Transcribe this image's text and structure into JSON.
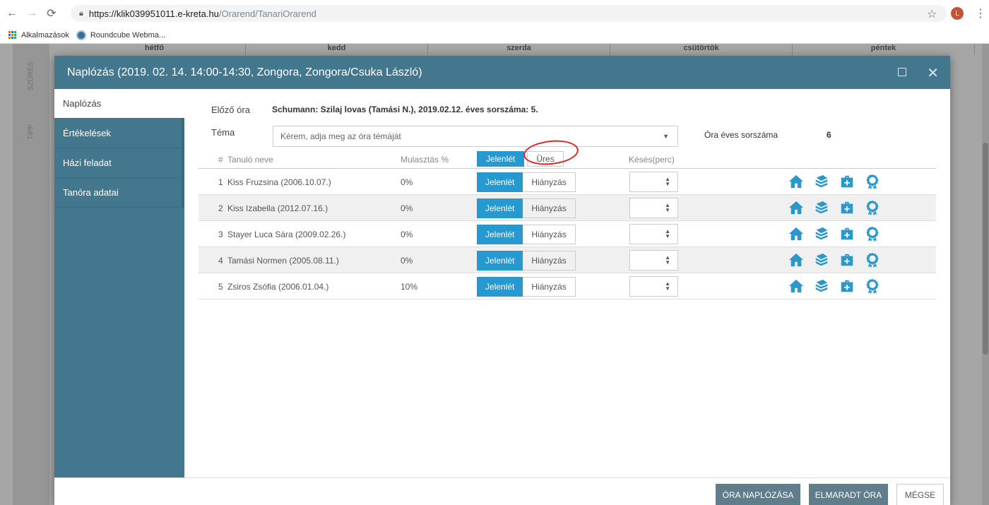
{
  "browser": {
    "url_host": "https://klik039951011.e-kreta.hu",
    "url_path": "/Orarend/TanariOrarend",
    "avatar_letter": "L",
    "bookmarks": [
      "Alkalmazások",
      "Roundcube Webma..."
    ]
  },
  "background": {
    "side_tabs": [
      "SZŰRÉS",
      "TIPP"
    ],
    "days": [
      "hétfő",
      "kedd",
      "szerda",
      "csütörtök",
      "péntek"
    ]
  },
  "modal": {
    "title": "Naplózás (2019. 02. 14. 14:00-14:30, Zongora, Zongora/Csuka László)",
    "side_menu": [
      "Naplózás",
      "Értékelések",
      "Házi feladat",
      "Tanóra adatai"
    ],
    "prev_label": "Előző óra",
    "prev_value": "Schumann: Szilaj lovas (Tamási N.), 2019.02.12. éves sorszáma: 5.",
    "tema_label": "Téma",
    "tema_placeholder": "Kérem, adja meg az óra témáját",
    "annual_label": "Óra éves sorszáma",
    "annual_value": "6",
    "headers": {
      "hash": "#",
      "name": "Tanuló neve",
      "absence": "Mulasztás %",
      "present": "Jelenlét",
      "empty": "Üres",
      "late": "Késés(perc)"
    },
    "students": [
      {
        "num": "1",
        "name": "Kiss Fruzsina (2006.10.07.)",
        "pct": "0%"
      },
      {
        "num": "2",
        "name": "Kiss Izabella (2012.07.16.)",
        "pct": "0%"
      },
      {
        "num": "3",
        "name": "Stayer Luca Sára (2009.02.26.)",
        "pct": "0%"
      },
      {
        "num": "4",
        "name": "Tamási Normen (2005.08.11.)",
        "pct": "0%"
      },
      {
        "num": "5",
        "name": "Zsiros Zsófia (2006.01.04.)",
        "pct": "10%"
      }
    ],
    "row_present": "Jelenlét",
    "row_absent": "Hiányzás",
    "footer": {
      "log": "ÓRA NAPLÓZÁSA",
      "missed": "ELMARADT ÓRA",
      "cancel": "MÉGSE"
    }
  },
  "colors": {
    "accent": "#2799d1",
    "header": "#42778d",
    "annotation": "#e02424"
  }
}
